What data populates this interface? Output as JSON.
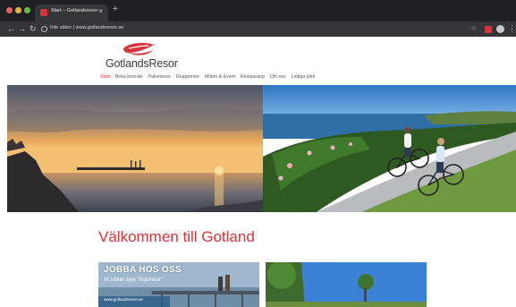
{
  "browser": {
    "tab_title": "Start – Gotlandsresor",
    "tab_close": "×",
    "new_tab": "+",
    "url": "Inte säker | www.gotlandsresor.se"
  },
  "site": {
    "logo_text": "GotlandsResor",
    "brand_color": "#d8343a",
    "nav": [
      "Start",
      "Boka boende",
      "Paketresor",
      "Gruppresor",
      "Möten & Event",
      "Restaurang",
      "Om oss",
      "Lediga jobb"
    ]
  },
  "hero": {
    "left_scene": "sunset over sea with pier",
    "right_scene": "two cyclists on coastal path"
  },
  "main": {
    "welcome_heading": "Välkommen till Gotland",
    "jobs_card": {
      "title": "JOBBA HOS OSS",
      "subtitle": "Vi söker nya \"kujonsor\"",
      "url": "www.gotlandsresor.se"
    }
  }
}
